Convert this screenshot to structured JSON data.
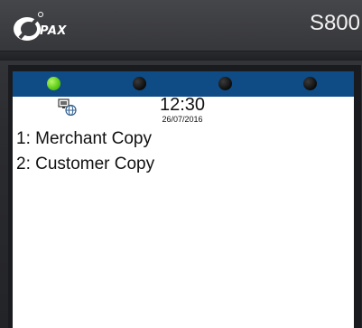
{
  "device": {
    "brand": "PAX",
    "model": "S800"
  },
  "status_bar": {
    "indicators": [
      {
        "name": "indicator-1",
        "state": "on",
        "color": "#5fcf19"
      },
      {
        "name": "indicator-2",
        "state": "off",
        "color": "#0b0b0b"
      },
      {
        "name": "indicator-3",
        "state": "off",
        "color": "#0b0b0b"
      },
      {
        "name": "indicator-4",
        "state": "off",
        "color": "#0b0b0b"
      }
    ],
    "bar_color": "#0f4c86"
  },
  "header": {
    "network_icon": "network-globe-icon",
    "time": "12:30",
    "date": "26/07/2016"
  },
  "menu": {
    "items": [
      {
        "label": "1: Merchant Copy"
      },
      {
        "label": "2: Customer Copy"
      }
    ]
  }
}
